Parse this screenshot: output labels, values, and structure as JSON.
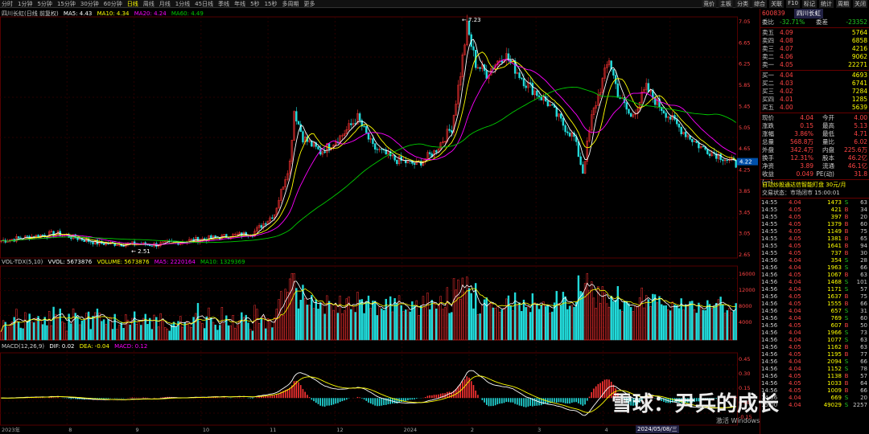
{
  "toolbar": {
    "periods": [
      "分时",
      "1分钟",
      "5分钟",
      "15分钟",
      "30分钟",
      "60分钟",
      "日线",
      "周线",
      "月线",
      "1分线",
      "45日线",
      "季线",
      "年线",
      "5秒",
      "15秒",
      "多周期",
      "更多"
    ],
    "active_period": "日线",
    "right_buttons": [
      "竞价",
      "主板",
      "分类",
      "综合",
      "关联",
      "F10",
      "标记",
      "统计",
      "周期",
      "关闭"
    ]
  },
  "legends": {
    "main_title": "四川长虹(日线 前复权)",
    "ma5": "MA5: 4.43",
    "ma10": "MA10: 4.34",
    "ma20": "MA20: 4.24",
    "ma60": "MA60: 4.49",
    "vol_title": "VOL-TDX(5,10)",
    "vol_value": "VVOL: 5673876",
    "volume": "VOLUME: 5673876",
    "vol_ma5": "MA5: 2220164",
    "vol_ma10": "MA10: 1329369",
    "macd_title": "MACD(12,26,9)",
    "dif": "DIF: 0.02",
    "dea": "DEA: -0.04",
    "macd": "MACD: 0.12"
  },
  "annotations": {
    "high_label": "7.23",
    "low_label": "2.51",
    "watermark": "雪球：尹兵的成长",
    "windows_watermark": "激活 Windows",
    "date_badge": "2024/05/08/三",
    "x_axis_year": "2023年"
  },
  "price_axis": [
    "7.05",
    "6.65",
    "6.25",
    "5.85",
    "5.45",
    "5.05",
    "4.65",
    "4.25",
    "3.85",
    "3.45",
    "3.05",
    "2.65"
  ],
  "current_price_tag": "4.22",
  "vol_axis": [
    "16000",
    "12000",
    "8000",
    "4000"
  ],
  "macd_axis": [
    "0.45",
    "0.30",
    "0.15",
    "0.00",
    "-0.15"
  ],
  "x_axis_labels": [
    "2023年",
    "8",
    "9",
    "10",
    "11",
    "12",
    "2024",
    "2",
    "3",
    "4",
    "5"
  ],
  "panel": {
    "code": "600839",
    "name": "四川长虹",
    "weibi_label": "委比",
    "weibi": "-32.71%",
    "weicha_label": "委差",
    "weicha": "-23352",
    "asks": [
      {
        "label": "卖五",
        "price": "4.09",
        "vol": "5764"
      },
      {
        "label": "卖四",
        "price": "4.08",
        "vol": "6858"
      },
      {
        "label": "卖三",
        "price": "4.07",
        "vol": "4216"
      },
      {
        "label": "卖二",
        "price": "4.06",
        "vol": "9062"
      },
      {
        "label": "卖一",
        "price": "4.05",
        "vol": "22271"
      }
    ],
    "bids": [
      {
        "label": "买一",
        "price": "4.04",
        "vol": "4693"
      },
      {
        "label": "买二",
        "price": "4.03",
        "vol": "6741"
      },
      {
        "label": "买三",
        "price": "4.02",
        "vol": "7284"
      },
      {
        "label": "买四",
        "price": "4.01",
        "vol": "1285"
      },
      {
        "label": "买五",
        "price": "4.00",
        "vol": "5639"
      }
    ],
    "stats": [
      {
        "l1": "现价",
        "v1": "4.04",
        "l2": "今开",
        "v2": "4.00"
      },
      {
        "l1": "涨跌",
        "v1": "0.15",
        "l2": "最高",
        "v2": "5.13"
      },
      {
        "l1": "涨幅",
        "v1": "3.86%",
        "l2": "最低",
        "v2": "4.71"
      },
      {
        "l1": "总量",
        "v1": "568.8万",
        "l2": "量比",
        "v2": "6.02"
      },
      {
        "l1": "外盘",
        "v1": "342.4万",
        "l2": "内盘",
        "v2": "225.6万"
      },
      {
        "l1": "换手",
        "v1": "12.31%",
        "l2": "股本",
        "v2": "46.2亿"
      },
      {
        "l1": "净资",
        "v1": "3.89",
        "l2": "流通",
        "v2": "46.1亿"
      },
      {
        "l1": "收益(一)",
        "v1": "0.049",
        "l2": "PE(动)",
        "v2": "31.8"
      }
    ],
    "notice": "自动炒股通达信智能盯盘 30元/月",
    "status": "交易状态：市场闭市 15:00:01",
    "trades": [
      {
        "t": "14:55",
        "p": "4.04",
        "v": "1473",
        "bs": "S",
        "n": "63"
      },
      {
        "t": "14:55",
        "p": "4.05",
        "v": "421",
        "bs": "B",
        "n": "34"
      },
      {
        "t": "14:55",
        "p": "4.05",
        "v": "397",
        "bs": "B",
        "n": "20"
      },
      {
        "t": "14:55",
        "p": "4.05",
        "v": "1379",
        "bs": "B",
        "n": "60"
      },
      {
        "t": "14:55",
        "p": "4.05",
        "v": "1149",
        "bs": "B",
        "n": "75"
      },
      {
        "t": "14:55",
        "p": "4.05",
        "v": "1381",
        "bs": "B",
        "n": "65"
      },
      {
        "t": "14:55",
        "p": "4.05",
        "v": "1641",
        "bs": "B",
        "n": "94"
      },
      {
        "t": "14:55",
        "p": "4.05",
        "v": "737",
        "bs": "B",
        "n": "30"
      },
      {
        "t": "14:56",
        "p": "4.04",
        "v": "354",
        "bs": "S",
        "n": "28"
      },
      {
        "t": "14:56",
        "p": "4.04",
        "v": "1963",
        "bs": "S",
        "n": "66"
      },
      {
        "t": "14:56",
        "p": "4.05",
        "v": "1067",
        "bs": "B",
        "n": "63"
      },
      {
        "t": "14:56",
        "p": "4.04",
        "v": "1468",
        "bs": "S",
        "n": "101"
      },
      {
        "t": "14:56",
        "p": "4.04",
        "v": "1171",
        "bs": "S",
        "n": "57"
      },
      {
        "t": "14:56",
        "p": "4.05",
        "v": "1637",
        "bs": "B",
        "n": "75"
      },
      {
        "t": "14:56",
        "p": "4.05",
        "v": "1555",
        "bs": "B",
        "n": "66"
      },
      {
        "t": "14:56",
        "p": "4.04",
        "v": "657",
        "bs": "S",
        "n": "31"
      },
      {
        "t": "14:56",
        "p": "4.04",
        "v": "769",
        "bs": "S",
        "n": "60"
      },
      {
        "t": "14:56",
        "p": "4.05",
        "v": "607",
        "bs": "B",
        "n": "50"
      },
      {
        "t": "14:56",
        "p": "4.04",
        "v": "1966",
        "bs": "S",
        "n": "73"
      },
      {
        "t": "14:56",
        "p": "4.04",
        "v": "1077",
        "bs": "S",
        "n": "63"
      },
      {
        "t": "14:56",
        "p": "4.05",
        "v": "1162",
        "bs": "B",
        "n": "63"
      },
      {
        "t": "14:56",
        "p": "4.05",
        "v": "1195",
        "bs": "B",
        "n": "77"
      },
      {
        "t": "14:56",
        "p": "4.04",
        "v": "2094",
        "bs": "S",
        "n": "66"
      },
      {
        "t": "14:56",
        "p": "4.04",
        "v": "1152",
        "bs": "S",
        "n": "78"
      },
      {
        "t": "14:56",
        "p": "4.05",
        "v": "1138",
        "bs": "B",
        "n": "57"
      },
      {
        "t": "14:56",
        "p": "4.05",
        "v": "1033",
        "bs": "B",
        "n": "64"
      },
      {
        "t": "14:56",
        "p": "4.05",
        "v": "1009",
        "bs": "B",
        "n": "66"
      },
      {
        "t": "14:56",
        "p": "4.04",
        "v": "669",
        "bs": "S",
        "n": "20"
      },
      {
        "t": "15:00",
        "p": "4.04",
        "v": "49029",
        "bs": "S",
        "n": "2257"
      }
    ]
  },
  "colors": {
    "up": "#ff3333",
    "down": "#22dddd",
    "ma5": "#ffffff",
    "ma10": "#ffff00",
    "ma20": "#ff00ff",
    "ma60": "#00cc00",
    "grid": "#550000"
  }
}
